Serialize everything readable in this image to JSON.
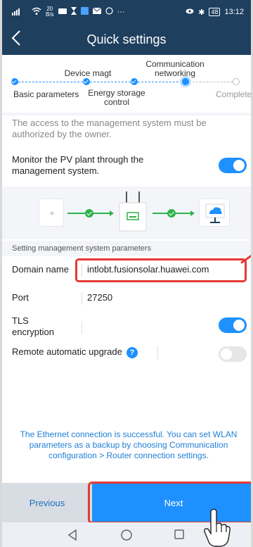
{
  "status_bar": {
    "left_text": "⁴⁶.ıl ᯤ 20 B/s",
    "icons": [
      "signal-icon",
      "wifi-icon",
      "message-icon",
      "hourglass-icon",
      "photo-icon",
      "mail-icon",
      "whatsapp-icon",
      "more-icon"
    ],
    "battery": "48",
    "time": "13:12"
  },
  "header": {
    "title": "Quick settings"
  },
  "stepper": {
    "steps": [
      {
        "label": "Basic parameters",
        "state": "done"
      },
      {
        "label": "Device magt",
        "state": "done"
      },
      {
        "label": "Energy storage control",
        "state": "done"
      },
      {
        "label": "Communication networking",
        "state": "current"
      },
      {
        "label": "Completed",
        "state": "pending"
      }
    ]
  },
  "info": {
    "text": "The access to the management system must be authorized by the owner."
  },
  "monitor": {
    "label": "Monitor the PV plant through the management system.",
    "enabled": true
  },
  "diagram": {
    "devices": [
      "inverter-icon",
      "router-icon",
      "cloud-server-icon"
    ]
  },
  "section": {
    "title": "Setting management system parameters"
  },
  "fields": {
    "domain": {
      "label": "Domain name",
      "value": "intlobt.fusionsolar.huawei.com"
    },
    "port": {
      "label": "Port",
      "value": "27250"
    },
    "tls": {
      "label": "TLS encryption",
      "enabled": true
    },
    "upgrade": {
      "label": "Remote automatic upgrade",
      "help": "?",
      "enabled": false
    }
  },
  "footer": {
    "message": "The Ethernet connection is successful. You can set WLAN parameters as a backup by choosing Communication configuration > Router connection settings."
  },
  "buttons": {
    "previous": "Previous",
    "next": "Next"
  },
  "colors": {
    "header_bg": "#1e3f5e",
    "accent": "#1e90ff",
    "highlight": "#e53935",
    "success": "#2eb24a"
  }
}
